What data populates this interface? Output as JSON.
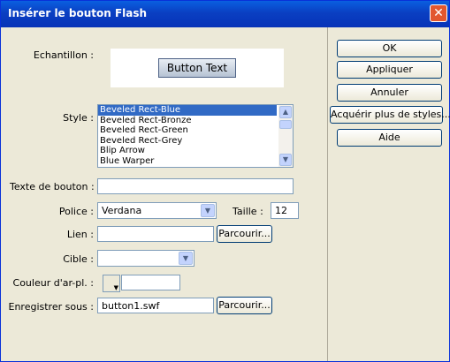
{
  "dialog": {
    "title": "Insérer le bouton Flash",
    "close_glyph": "✕"
  },
  "sample": {
    "label": "Echantillon :",
    "button_text": "Button Text"
  },
  "style": {
    "label": "Style :",
    "items": [
      "Beveled Rect-Blue",
      "Beveled Rect-Bronze",
      "Beveled Rect-Green",
      "Beveled Rect-Grey",
      "Blip Arrow",
      "Blue Warper"
    ],
    "selected_index": 0
  },
  "button_text": {
    "label": "Texte de bouton :",
    "value": ""
  },
  "font": {
    "label": "Police :",
    "value": "Verdana",
    "size_label": "Taille :",
    "size_value": "12"
  },
  "link": {
    "label": "Lien :",
    "value": "",
    "browse_label": "Parcourir..."
  },
  "target": {
    "label": "Cible :",
    "value": ""
  },
  "bg_color": {
    "label": "Couleur d'ar-pl. :",
    "value": ""
  },
  "save_as": {
    "label": "Enregistrer sous :",
    "value": "button1.swf",
    "browse_label": "Parcourir..."
  },
  "actions": {
    "ok": "OK",
    "apply": "Appliquer",
    "cancel": "Annuler",
    "more_styles": "Acquérir plus de styles...",
    "help": "Aide"
  },
  "icons": {
    "close": "close-icon",
    "dropdown": "chevron-down-icon",
    "scroll_up": "chevron-up-icon",
    "scroll_down": "chevron-down-icon"
  },
  "colors": {
    "titlebar": "#0a5fe0",
    "selection": "#316ac5",
    "dialog_bg": "#ece9d8",
    "close_button": "#e2572f"
  }
}
